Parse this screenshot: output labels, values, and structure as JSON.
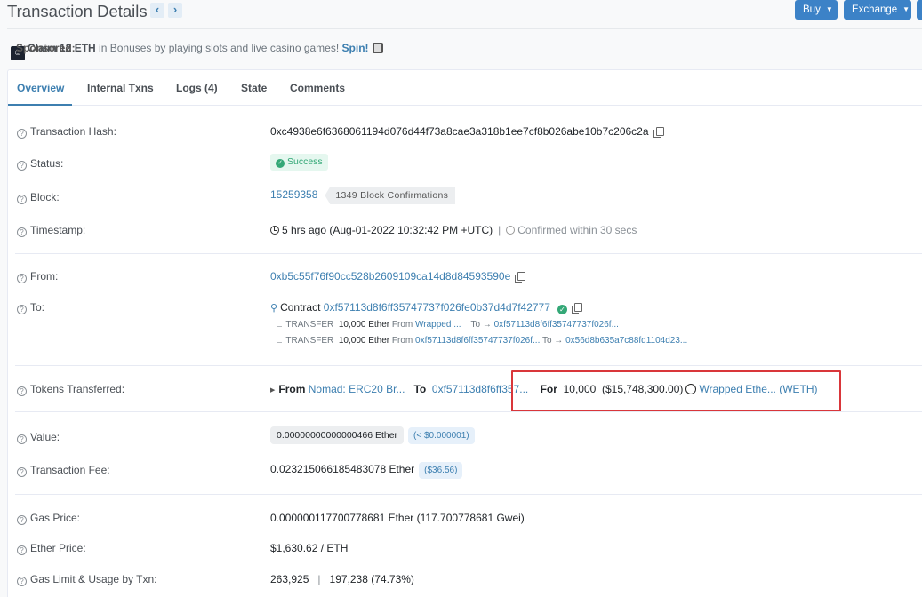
{
  "header": {
    "title": "Transaction Details",
    "prev_label": "‹",
    "next_label": "›",
    "buy_label": "Buy",
    "exchange_label": "Exchange"
  },
  "sponsored": {
    "label": "Sponsored:",
    "headline": "Claim 12 ETH",
    "text": " in Bonuses by playing slots and live casino games! ",
    "cta": "Spin!"
  },
  "tabs": [
    {
      "label": "Overview",
      "active": true
    },
    {
      "label": "Internal Txns",
      "active": false
    },
    {
      "label": "Logs (4)",
      "active": false
    },
    {
      "label": "State",
      "active": false
    },
    {
      "label": "Comments",
      "active": false
    }
  ],
  "fields": {
    "tx_hash": {
      "label": "Transaction Hash:",
      "value": "0xc4938e6f6368061194d076d44f73a8cae3a318b1ee7cf8b026abe10b7c206c2a"
    },
    "status": {
      "label": "Status:",
      "value": "Success"
    },
    "block": {
      "label": "Block:",
      "number": "15259358",
      "confirmations": "1349 Block Confirmations"
    },
    "timestamp": {
      "label": "Timestamp:",
      "value": "5 hrs ago (Aug-01-2022 10:32:42 PM +UTC)",
      "separator": "|",
      "confirmed": "Confirmed within 30 secs"
    },
    "from": {
      "label": "From:",
      "value": "0xb5c55f76f90cc528b2609109ca14d8d84593590e"
    },
    "to": {
      "label": "To:",
      "prefix": "Contract",
      "value": "0xf57113d8f6ff35747737f026fe0b37d4d7f42777",
      "transfers": [
        {
          "type": "TRANSFER",
          "amount": "10,000 Ether",
          "from_label": "From",
          "from": "Wrapped ...",
          "to_label": "To →",
          "to": "0xf57113d8f6ff35747737f026f..."
        },
        {
          "type": "TRANSFER",
          "amount": "10,000 Ether",
          "from_label": "From",
          "from": "0xf57113d8f6ff35747737f026f...",
          "to_label": "To →",
          "to": "0x56d8b635a7c88fd1104d23..."
        }
      ]
    },
    "tokens": {
      "label": "Tokens Transferred:",
      "from_label": "From",
      "from": "Nomad: ERC20 Br...",
      "to_label": "To",
      "to": "0xf57113d8f6ff357...",
      "for_label": "For",
      "amount": "10,000",
      "usd": "($15,748,300.00)",
      "token": "Wrapped Ethe... (WETH)"
    },
    "value": {
      "label": "Value:",
      "ether": "0.00000000000000466 Ether",
      "usd": "(< $0.000001)"
    },
    "fee": {
      "label": "Transaction Fee:",
      "ether": "0.023215066185483078 Ether",
      "usd": "($36.56)"
    },
    "gas_price": {
      "label": "Gas Price:",
      "value": "0.000000117700778681 Ether (117.700778681 Gwei)"
    },
    "ether_price": {
      "label": "Ether Price:",
      "value": "$1,630.62 / ETH"
    },
    "gas_limit": {
      "label": "Gas Limit & Usage by Txn:",
      "limit": "263,925",
      "separator": "|",
      "usage": "197,238 (74.73%)"
    }
  }
}
